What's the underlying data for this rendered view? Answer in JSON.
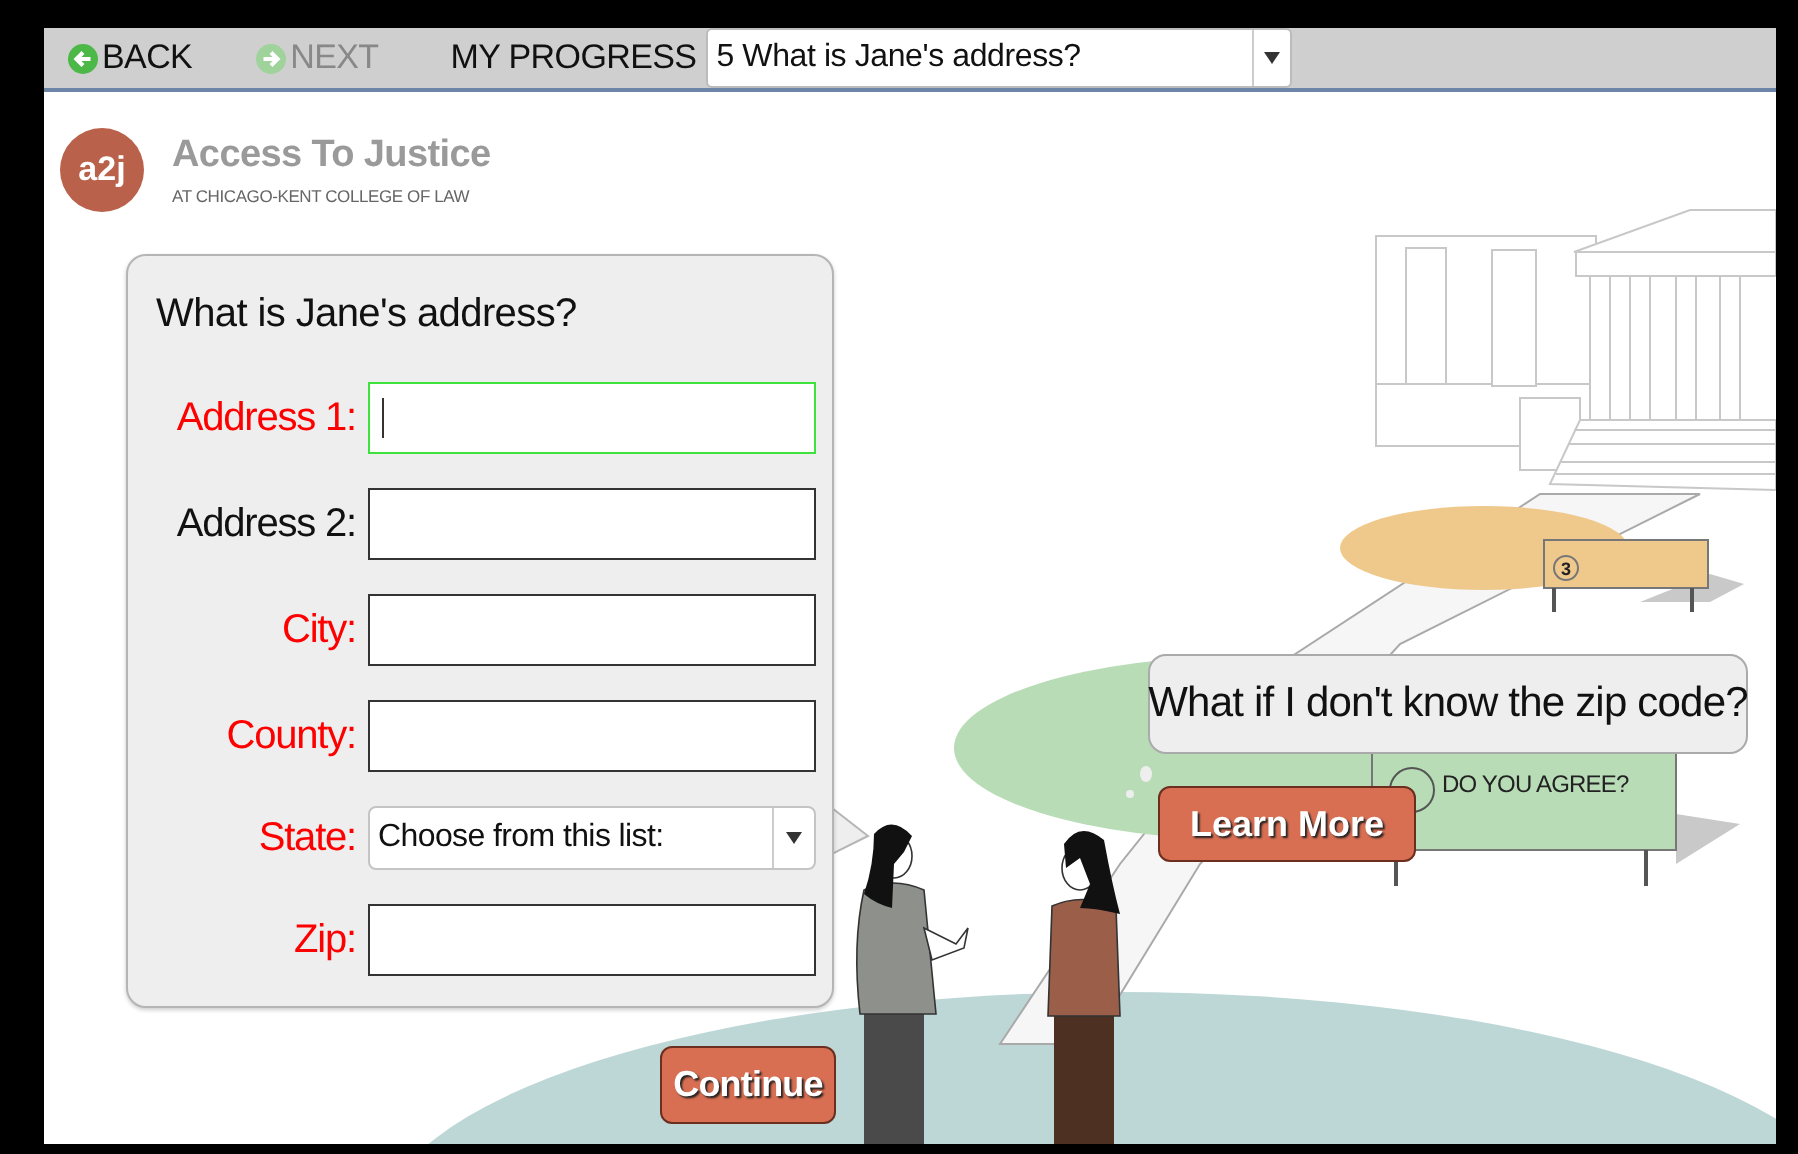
{
  "nav": {
    "back": "BACK",
    "next": "NEXT",
    "next_disabled": true,
    "progress_label": "MY PROGRESS",
    "progress_value": "5 What is Jane's address?"
  },
  "logo": {
    "mark": "a2j",
    "title": "Access To Justice",
    "subtitle": "AT CHICAGO-KENT COLLEGE OF LAW"
  },
  "question": {
    "text": "What is Jane's address?",
    "fields": [
      {
        "kind": "text",
        "label": "Address 1:",
        "required": true,
        "focused": true
      },
      {
        "kind": "text",
        "label": "Address 2:",
        "required": false,
        "focused": false
      },
      {
        "kind": "text",
        "label": "City:",
        "required": true,
        "focused": false
      },
      {
        "kind": "text",
        "label": "County:",
        "required": true,
        "focused": false
      },
      {
        "kind": "select",
        "label": "State:",
        "required": true,
        "focused": false,
        "value": "Choose from this list:"
      },
      {
        "kind": "text",
        "label": "Zip:",
        "required": true,
        "focused": false
      }
    ]
  },
  "help": {
    "question": "What if I don't know the zip code?",
    "button": "Learn More"
  },
  "scene": {
    "sign_number": "3",
    "sign_caption": "DO YOU AGREE?"
  },
  "continue": "Continue"
}
